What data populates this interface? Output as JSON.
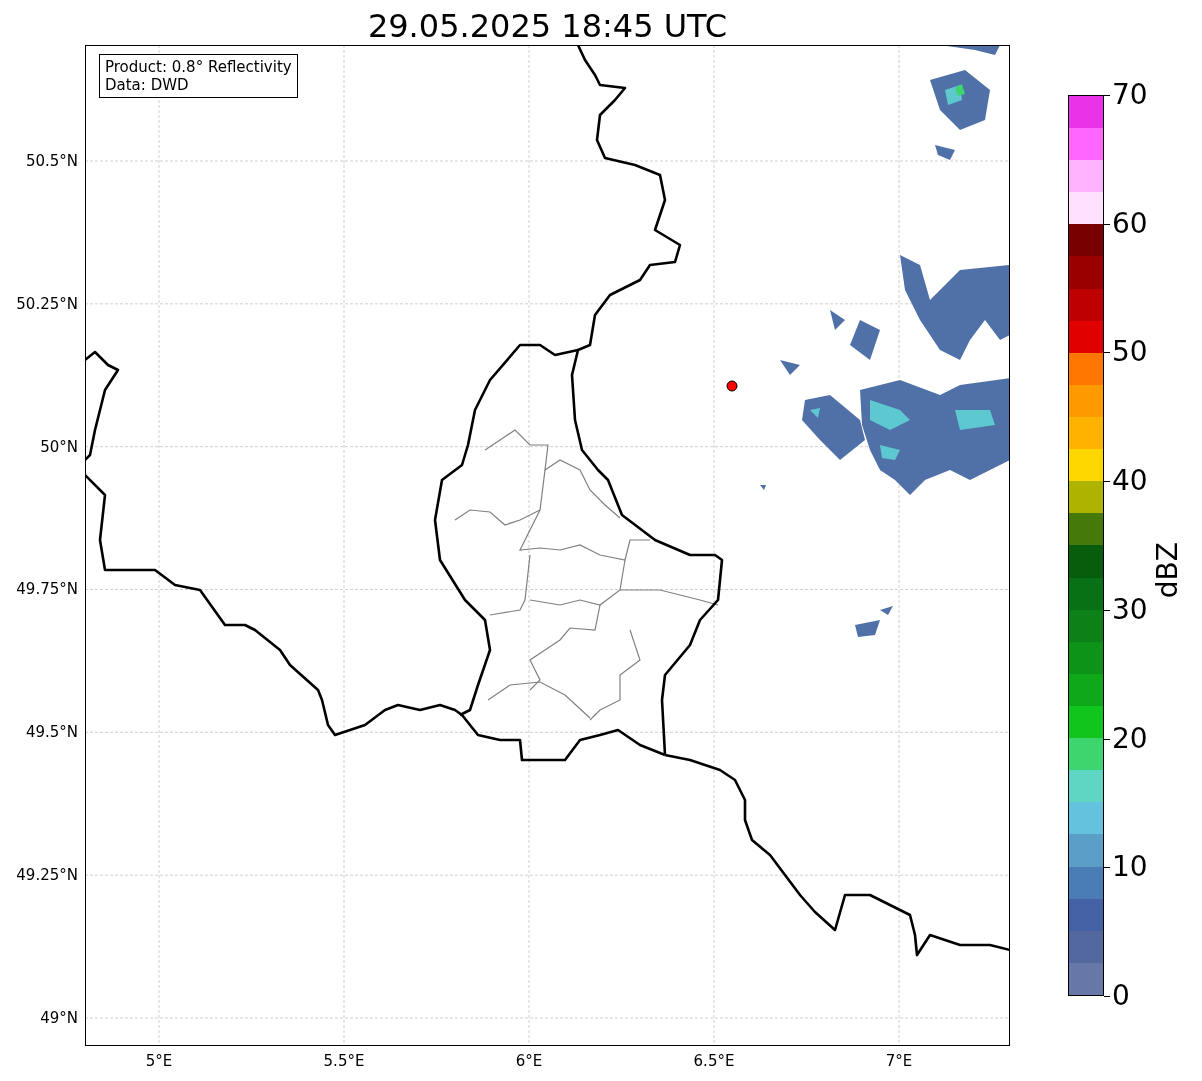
{
  "title": "29.05.2025 18:45 UTC",
  "info_box": [
    "Product: 0.8° Reflectivity",
    "Data: DWD"
  ],
  "map": {
    "xticks": [
      "5°E",
      "5.5°E",
      "6°E",
      "6.5°E",
      "7°E"
    ],
    "yticks": [
      "50.5°N",
      "50.25°N",
      "50°N",
      "49.75°N",
      "49.5°N",
      "49.25°N",
      "49°N"
    ]
  },
  "colorbar": {
    "label": "dBZ",
    "ticks": [
      "70",
      "60",
      "50",
      "40",
      "30",
      "20",
      "10",
      "0"
    ],
    "bins": [
      {
        "color": "#6777a8"
      },
      {
        "color": "#5468a0"
      },
      {
        "color": "#4461a6"
      },
      {
        "color": "#4a7db5"
      },
      {
        "color": "#5b9fc8"
      },
      {
        "color": "#63c2de"
      },
      {
        "color": "#5ed6c3"
      },
      {
        "color": "#3dd66e"
      },
      {
        "color": "#10c51c"
      },
      {
        "color": "#0fa81a"
      },
      {
        "color": "#0d9418"
      },
      {
        "color": "#0b8118"
      },
      {
        "color": "#087015"
      },
      {
        "color": "#075d0c"
      },
      {
        "color": "#457a0a"
      },
      {
        "color": "#aeb300"
      },
      {
        "color": "#ffd700"
      },
      {
        "color": "#ffb300"
      },
      {
        "color": "#ff9900"
      },
      {
        "color": "#ff7700"
      },
      {
        "color": "#e00000"
      },
      {
        "color": "#be0000"
      },
      {
        "color": "#9a0000"
      },
      {
        "color": "#780000"
      },
      {
        "color": "#ffe0ff"
      },
      {
        "color": "#ffb3ff"
      },
      {
        "color": "#ff66ff"
      },
      {
        "color": "#e833e8"
      }
    ]
  }
}
